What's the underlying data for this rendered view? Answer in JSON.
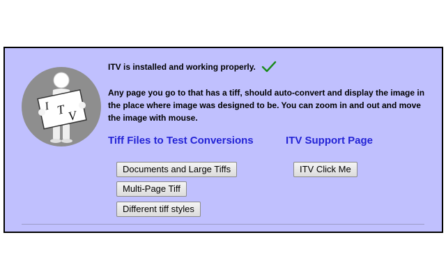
{
  "status": {
    "message": "ITV is installed and working properly.",
    "check_icon": "checkmark-icon",
    "check_color": "#1a8a1a"
  },
  "description": "Any page you go to that has a tiff, should auto-convert and display the image in the place where image was designed to be. You can zoom in and out and move the image with mouse.",
  "logo": {
    "icon": "itv-logo-figure-holding-sign",
    "sign_text_1": "I",
    "sign_text_2": "T",
    "sign_text_3": "V"
  },
  "links": {
    "tiff_files": "Tiff Files to Test Conversions",
    "support": "ITV Support Page"
  },
  "buttons": {
    "documents": "Documents and Large Tiffs",
    "multipage": "Multi-Page Tiff",
    "styles": "Different tiff styles",
    "click_me": "ITV Click Me"
  },
  "colors": {
    "panel_bg": "#c0c0fe",
    "link": "#2323d6"
  }
}
